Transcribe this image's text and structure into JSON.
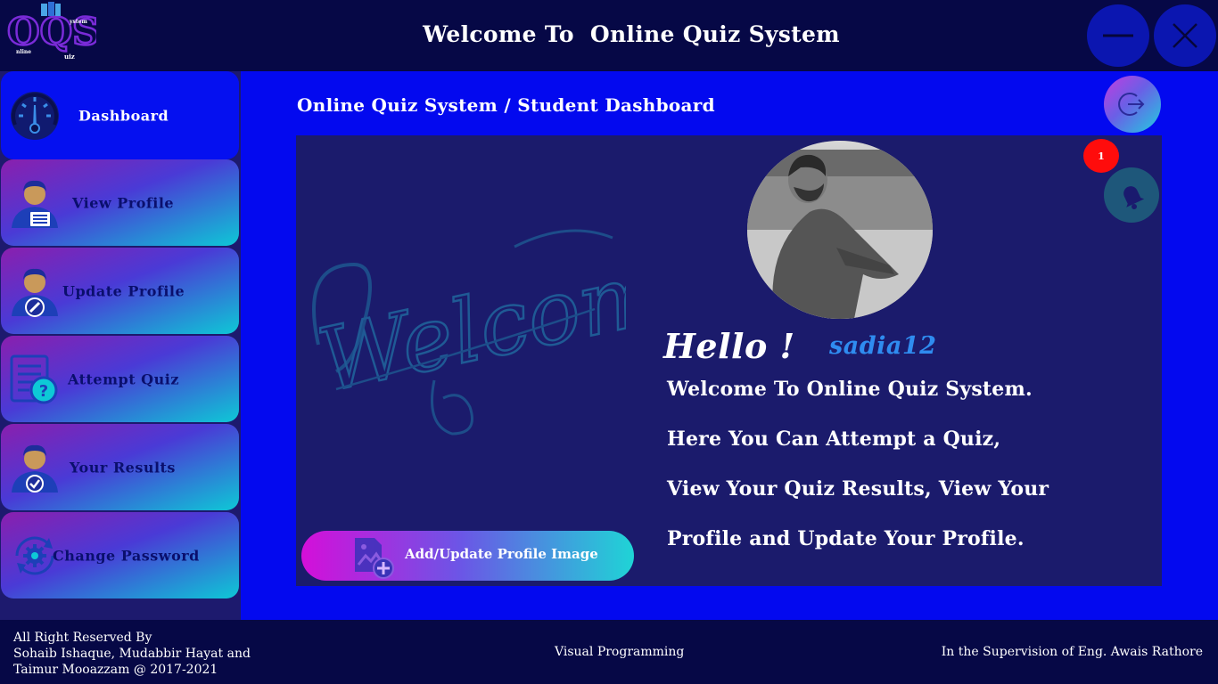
{
  "header": {
    "logo": {
      "big_letters": "OQS",
      "small_top": "ystem",
      "small_left": "nline",
      "small_bottom": "uiz"
    },
    "title": "Welcome To  Online Quiz System",
    "minimize_icon": "minus-icon",
    "close_icon": "close-icon"
  },
  "sidebar": {
    "items": [
      {
        "label": "Dashboard",
        "icon": "dashboard-gauge-icon",
        "active": true
      },
      {
        "label": "View Profile",
        "icon": "user-card-icon",
        "active": false
      },
      {
        "label": "Update Profile",
        "icon": "user-edit-icon",
        "active": false
      },
      {
        "label": "Attempt Quiz",
        "icon": "quiz-document-icon",
        "active": false
      },
      {
        "label": "Your Results",
        "icon": "user-check-icon",
        "active": false
      },
      {
        "label": "Change Password",
        "icon": "gear-refresh-icon",
        "active": false
      }
    ]
  },
  "main": {
    "breadcrumb": "Online Quiz System / Student Dashboard",
    "logout_icon": "logout-icon",
    "notification_count": "1",
    "bell_icon": "bell-icon",
    "welcome_art_text": "Welcome",
    "add_image_button": "Add/Update Profile Image",
    "greeting": "Hello !",
    "username": "sadia12",
    "message_lines": [
      "Welcome To Online Quiz System.",
      "Here You Can Attempt a Quiz,",
      "View Your Quiz Results, View Your",
      "Profile and Update Your Profile."
    ]
  },
  "footer": {
    "credits_lines": [
      "All Right Reserved By",
      "Sohaib Ishaque, Mudabbir Hayat and",
      "Taimur Mooazzam @ 2017-2021"
    ],
    "course": "Visual Programming",
    "supervision": "In the Supervision of Eng. Awais Rathore"
  },
  "colors": {
    "header_bg": "#060846",
    "main_bg": "#0309ef",
    "panel_bg": "#1b1b6c",
    "active_nav": "#0510f0",
    "username": "#2f8cf0",
    "badge": "#ff0c0c"
  }
}
